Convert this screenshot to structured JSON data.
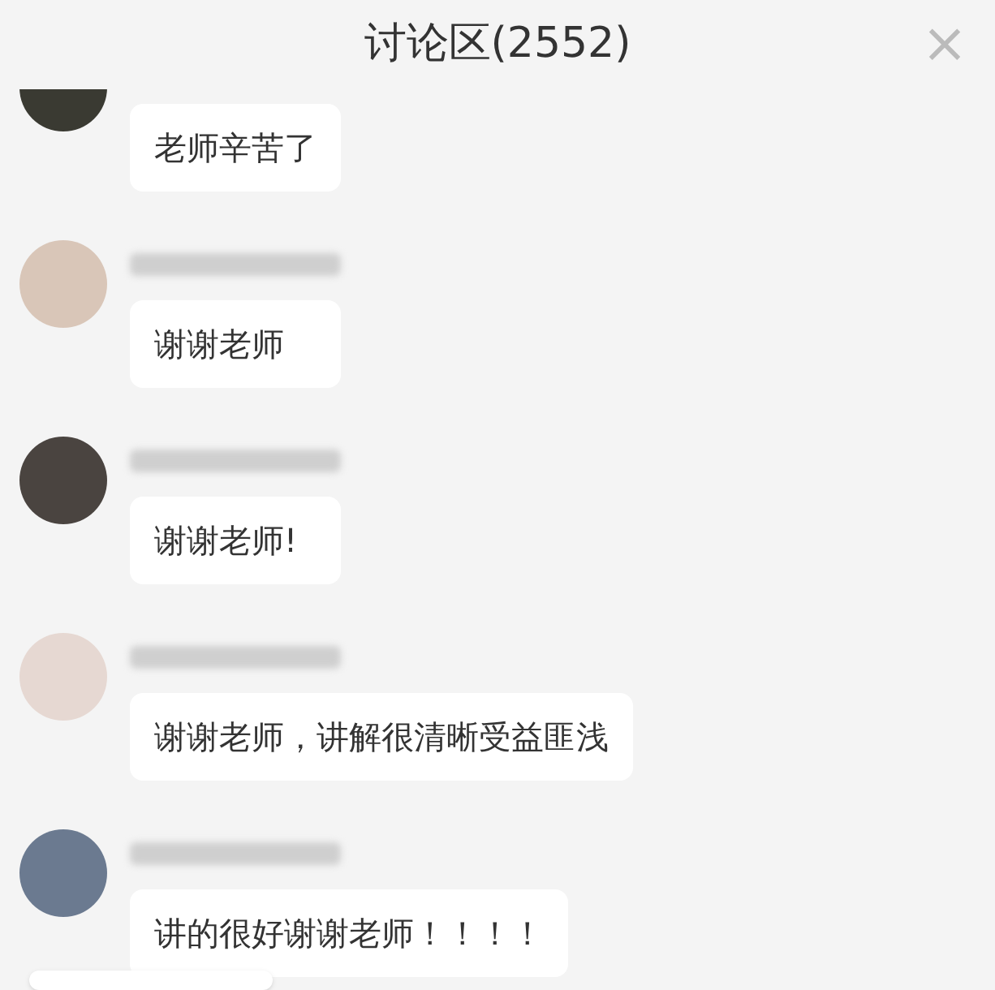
{
  "header": {
    "title": "讨论区(2552)",
    "close": "×"
  },
  "messages": [
    {
      "text": "老师辛苦了",
      "name_visible": false
    },
    {
      "text": "谢谢老师",
      "name_visible": true
    },
    {
      "text": "谢谢老师!",
      "name_visible": true
    },
    {
      "text": "谢谢老师，讲解很清晰受益匪浅",
      "name_visible": true
    },
    {
      "text": "讲的很好谢谢老师！！！！",
      "name_visible": true
    }
  ]
}
